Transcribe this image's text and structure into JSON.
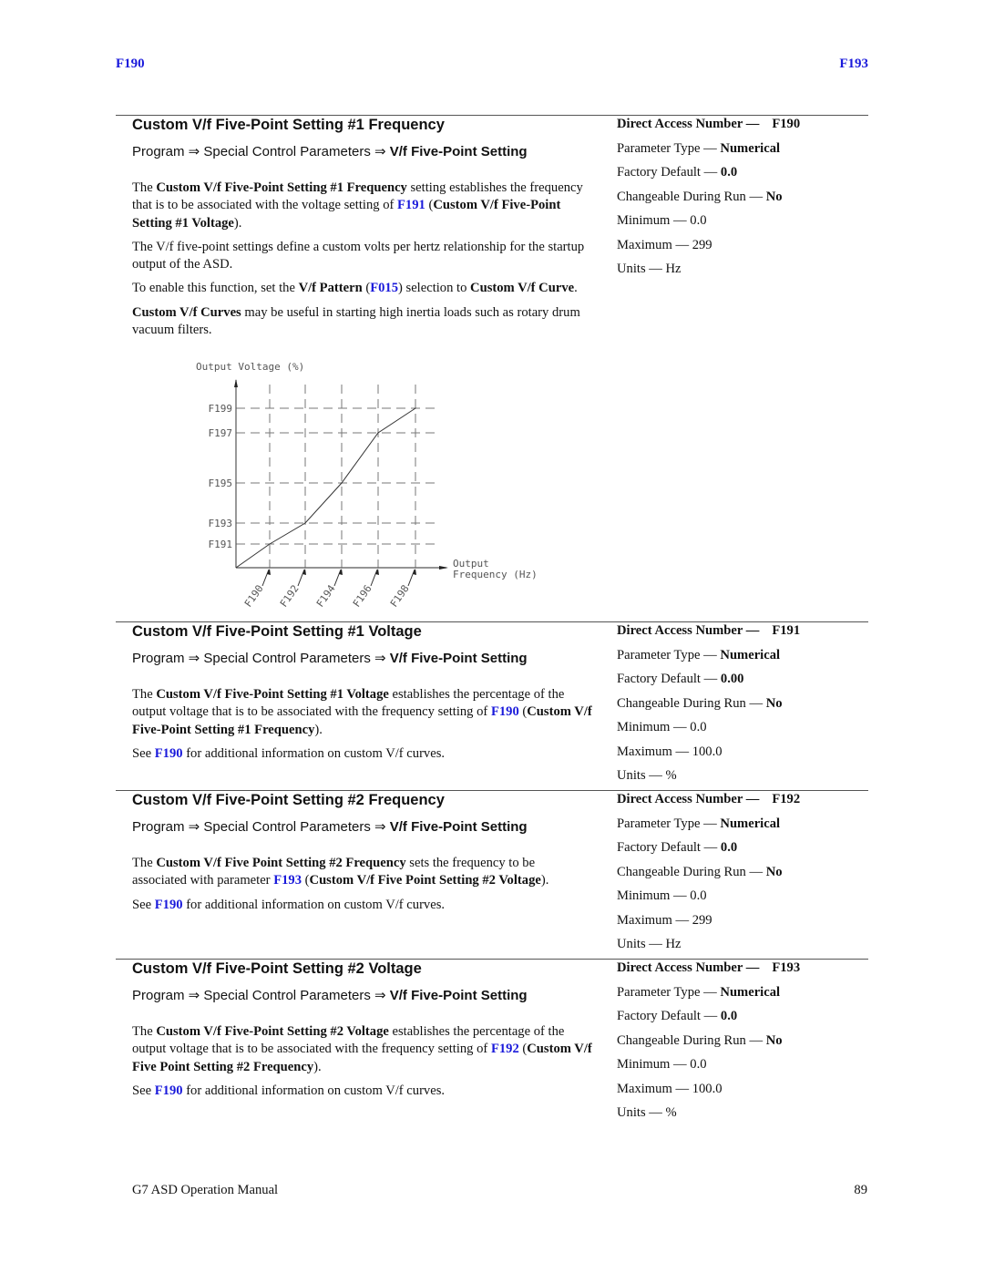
{
  "header": {
    "left_link": "F190",
    "right_link": "F193"
  },
  "path": {
    "prefix": "Program ⇒ Special Control Parameters ⇒ ",
    "bold": "V/f Five-Point Setting"
  },
  "sections": [
    {
      "title": "Custom V/f Five-Point Setting #1 Frequency",
      "paragraphs": [
        [
          {
            "t": "The "
          },
          {
            "b": "Custom V/f Five-Point Setting #1 Frequency"
          },
          {
            "t": " setting establishes the frequency that is to be associated with the voltage setting of "
          },
          {
            "l": "F191"
          },
          {
            "t": " ("
          },
          {
            "b": "Custom V/f Five-Point Setting #1 Voltage"
          },
          {
            "t": ")."
          }
        ],
        [
          {
            "t": "The V/f five-point settings define a custom volts per hertz relationship for the startup output of the ASD."
          }
        ],
        [
          {
            "t": "To enable this function, set the "
          },
          {
            "b": "V/f Pattern"
          },
          {
            "t": " ("
          },
          {
            "l": "F015"
          },
          {
            "t": ") selection to "
          },
          {
            "b": "Custom V/f Curve"
          },
          {
            "t": "."
          }
        ],
        [
          {
            "b": "Custom V/f Curves"
          },
          {
            "t": " may be useful in starting high inertia loads such as rotary drum vacuum filters."
          }
        ]
      ],
      "props": {
        "direct_access_label": "Direct Access Number —",
        "direct_access_value": "F190",
        "parameter_type_label": "Parameter Type — ",
        "parameter_type_value": "Numerical",
        "factory_default_label": "Factory Default — ",
        "factory_default_value": "0.0",
        "changeable_label": "Changeable During Run — ",
        "changeable_value": "No",
        "minimum": "Minimum — 0.0",
        "maximum": "Maximum — 299",
        "units": "Units — Hz"
      }
    },
    {
      "title": "Custom V/f Five-Point Setting #1 Voltage",
      "paragraphs": [
        [
          {
            "t": "The "
          },
          {
            "b": "Custom V/f Five-Point Setting #1 Voltage"
          },
          {
            "t": " establishes the percentage of the output voltage that is to be associated with the frequency setting of "
          },
          {
            "l": "F190"
          },
          {
            "t": " ("
          },
          {
            "b": "Custom V/f Five-Point Setting #1 Frequency"
          },
          {
            "t": ")."
          }
        ],
        [
          {
            "t": "See "
          },
          {
            "l": "F190"
          },
          {
            "t": " for additional information on custom V/f curves."
          }
        ]
      ],
      "props": {
        "direct_access_label": "Direct Access Number —",
        "direct_access_value": "F191",
        "parameter_type_label": "Parameter Type — ",
        "parameter_type_value": "Numerical",
        "factory_default_label": "Factory Default — ",
        "factory_default_value": "0.00",
        "changeable_label": "Changeable During Run — ",
        "changeable_value": "No",
        "minimum": "Minimum — 0.0",
        "maximum": "Maximum — 100.0",
        "units": "Units — %"
      }
    },
    {
      "title": "Custom V/f Five-Point Setting #2 Frequency",
      "paragraphs": [
        [
          {
            "t": "The "
          },
          {
            "b": "Custom V/f Five Point Setting #2 Frequency"
          },
          {
            "t": " sets the frequency to be associated with parameter "
          },
          {
            "l": "F193"
          },
          {
            "t": " ("
          },
          {
            "b": "Custom V/f Five Point Setting #2 Voltage"
          },
          {
            "t": ")."
          }
        ],
        [
          {
            "t": "See "
          },
          {
            "l": "F190"
          },
          {
            "t": " for additional information on custom V/f curves."
          }
        ]
      ],
      "props": {
        "direct_access_label": "Direct Access Number —",
        "direct_access_value": "F192",
        "parameter_type_label": "Parameter Type — ",
        "parameter_type_value": "Numerical",
        "factory_default_label": "Factory Default — ",
        "factory_default_value": "0.0",
        "changeable_label": "Changeable During Run — ",
        "changeable_value": "No",
        "minimum": "Minimum — 0.0",
        "maximum": "Maximum — 299",
        "units": "Units — Hz"
      }
    },
    {
      "title": "Custom V/f Five-Point Setting #2 Voltage",
      "paragraphs": [
        [
          {
            "t": "The "
          },
          {
            "b": "Custom V/f Five-Point Setting #2 Voltage"
          },
          {
            "t": " establishes the percentage of the output voltage that is to be associated with the frequency setting of "
          },
          {
            "l": "F192"
          },
          {
            "t": " ("
          },
          {
            "b": "Custom V/f Five Point Setting #2 Frequency"
          },
          {
            "t": ")."
          }
        ],
        [
          {
            "t": "See "
          },
          {
            "l": "F190"
          },
          {
            "t": " for additional information on custom V/f curves."
          }
        ]
      ],
      "props": {
        "direct_access_label": "Direct Access Number —",
        "direct_access_value": "F193",
        "parameter_type_label": "Parameter Type — ",
        "parameter_type_value": "Numerical",
        "factory_default_label": "Factory Default — ",
        "factory_default_value": "0.0",
        "changeable_label": "Changeable During Run — ",
        "changeable_value": "No",
        "minimum": "Minimum — 0.0",
        "maximum": "Maximum — 100.0",
        "units": "Units — %"
      }
    }
  ],
  "chart_data": {
    "type": "line",
    "title": "",
    "ylabel": "Output Voltage (%)",
    "xlabel_line1": "Output",
    "xlabel_line2": "Frequency (Hz)",
    "x_ticks": [
      "F190",
      "F192",
      "F194",
      "F196",
      "F198"
    ],
    "y_ticks": [
      "F191",
      "F193",
      "F195",
      "F197",
      "F199"
    ],
    "grid": true,
    "grid_style": "dashed",
    "series": [
      {
        "name": "Custom V/f curve",
        "points": [
          {
            "x": "origin",
            "y": "origin"
          },
          {
            "x": "F190",
            "y": "F191"
          },
          {
            "x": "F192",
            "y": "F193"
          },
          {
            "x": "F194",
            "y": "F195"
          },
          {
            "x": "F196",
            "y": "F197"
          },
          {
            "x": "F198",
            "y": "F199"
          }
        ]
      }
    ]
  },
  "footer": {
    "manual_title": "G7 ASD Operation Manual",
    "page_number": "89"
  }
}
